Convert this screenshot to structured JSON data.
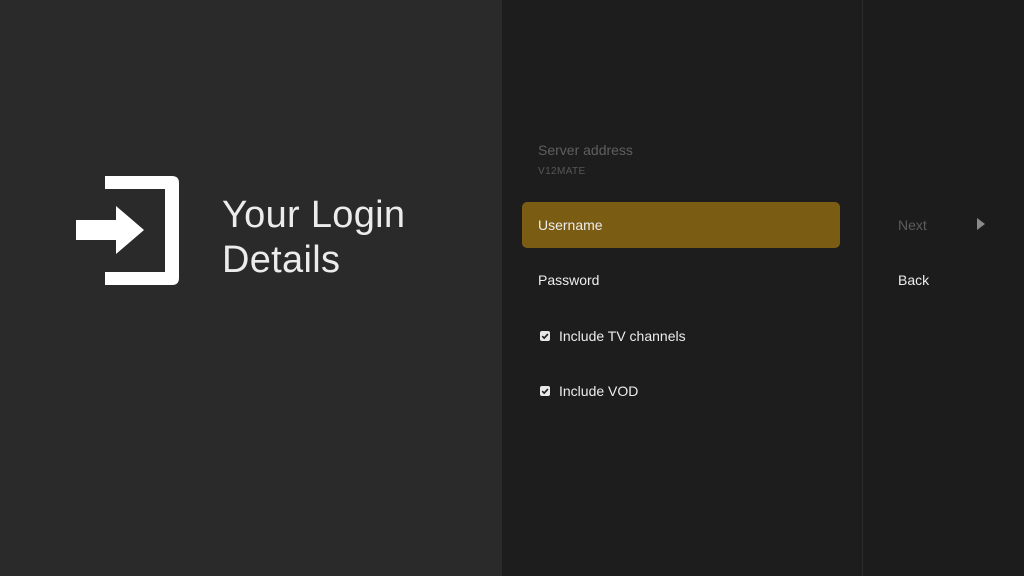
{
  "header": {
    "title_line1": "Your Login",
    "title_line2": "Details",
    "icon": "login-icon"
  },
  "form": {
    "server_label": "Server address",
    "server_value": "V12MATE",
    "username_label": "Username",
    "password_label": "Password",
    "include_tv_label": "Include TV channels",
    "include_tv_checked": true,
    "include_vod_label": "Include VOD",
    "include_vod_checked": true
  },
  "actions": {
    "next_label": "Next",
    "next_icon": "arrow-right-icon",
    "back_label": "Back"
  },
  "colors": {
    "accent": "#7a5d13",
    "left_panel": "#2a2a2a",
    "middle_panel": "#1d1d1d",
    "right_panel": "#1c1c1c",
    "text_primary": "#ececec",
    "text_dim": "#5c5c5c"
  }
}
